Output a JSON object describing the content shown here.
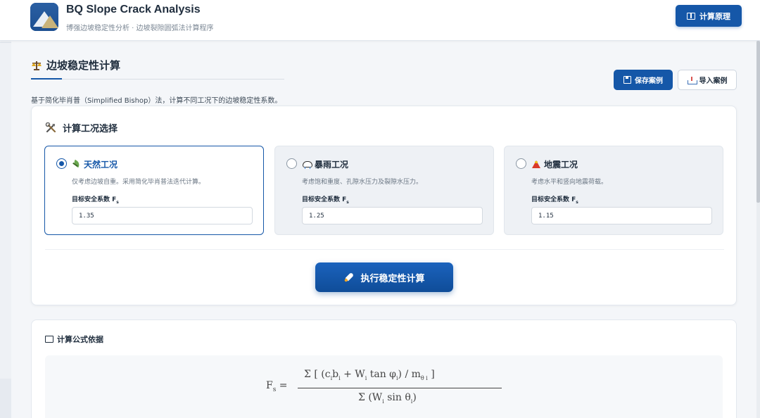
{
  "header": {
    "title": "BQ Slope Crack Analysis",
    "subtitle": "博强边坡稳定性分析 · 边坡裂隙圆弧法计算程序",
    "theory_button": "计算原理"
  },
  "section": {
    "title": "边坡稳定性计算",
    "save_button": "保存案例",
    "import_button": "导入案例",
    "description": "基于简化毕肖普（Simplified Bishop）法，计算不同工况下的边坡稳定性系数。"
  },
  "conditions": {
    "title": "计算工况选择",
    "items": [
      {
        "label": "天然工况",
        "desc": "仅考虑边坡自重。采用简化毕肖普法迭代计算。",
        "field_label": "目标安全系数 F",
        "field_sub": "s",
        "value": "1.35",
        "selected": true,
        "icon": "leaf-icon"
      },
      {
        "label": "暴雨工况",
        "desc": "考虑饱和重度、孔隙水压力及裂隙水压力。",
        "field_label": "目标安全系数 F",
        "field_sub": "s",
        "value": "1.25",
        "selected": false,
        "icon": "rain-cloud-icon"
      },
      {
        "label": "地震工况",
        "desc": "考虑水平和竖向地震荷载。",
        "field_label": "目标安全系数 F",
        "field_sub": "s",
        "value": "1.15",
        "selected": false,
        "icon": "volcano-icon"
      }
    ],
    "execute_button": "执行稳定性计算"
  },
  "formula": {
    "title": "计算公式依据",
    "lhs": "F",
    "lhs_sub": "s",
    "equals": "=",
    "numerator": "Σ [ (c",
    "denominator": "Σ (W"
  },
  "colors": {
    "primary": "#1557a8",
    "selected_border": "#1557a8",
    "background": "#f4f6f9"
  }
}
